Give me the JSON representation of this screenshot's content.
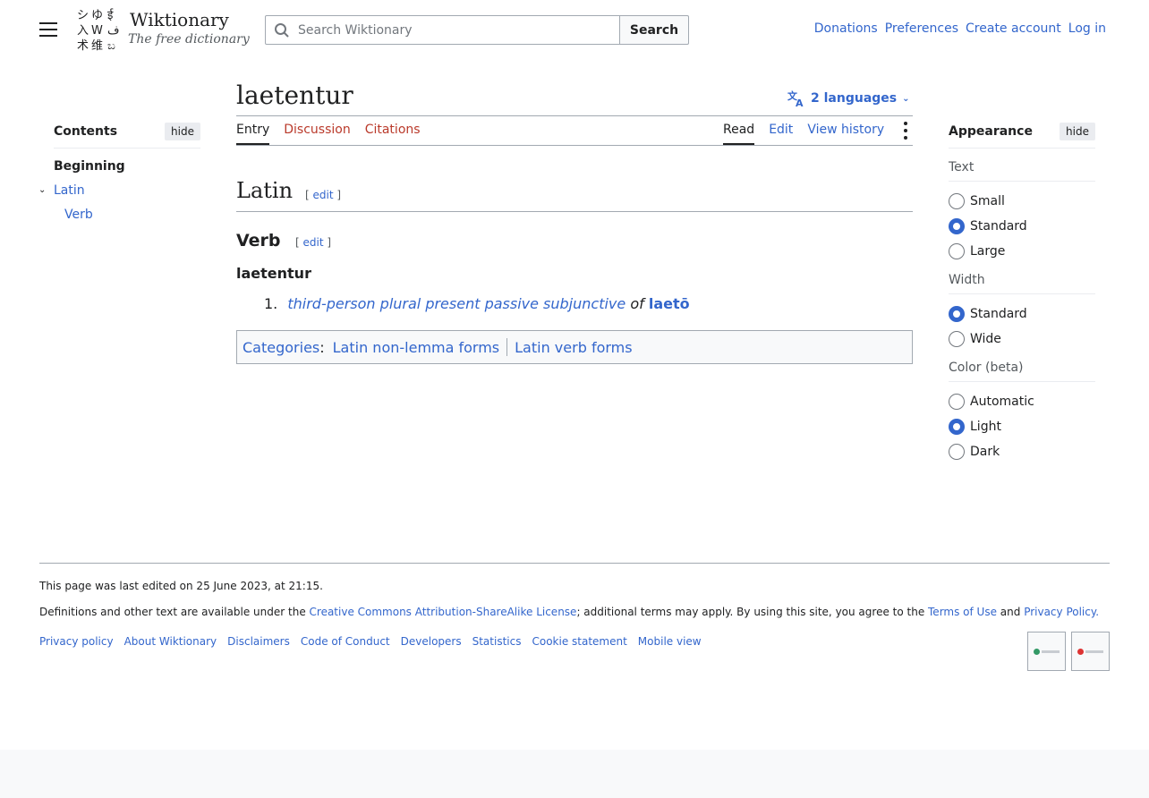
{
  "header": {
    "site_name": "Wiktionary",
    "tagline": "The free dictionary",
    "search_placeholder": "Search Wiktionary",
    "search_button": "Search",
    "user_links": [
      "Donations",
      "Preferences",
      "Create account",
      "Log in"
    ]
  },
  "toc": {
    "title": "Contents",
    "hide_label": "hide",
    "beginning": "Beginning",
    "sections": [
      {
        "label": "Latin",
        "children": [
          "Verb"
        ]
      }
    ]
  },
  "page": {
    "title": "laetentur",
    "languages_label": "2 languages",
    "tabs_left": [
      "Entry",
      "Discussion",
      "Citations"
    ],
    "tabs_right": [
      "Read",
      "Edit",
      "View history"
    ]
  },
  "content": {
    "language_heading": "Latin",
    "pos_heading": "Verb",
    "edit_open": "[",
    "edit_label": "edit",
    "edit_close": "]",
    "headword": "laetentur",
    "definition": {
      "number": "1.",
      "form": "third-person plural present passive subjunctive",
      "of": "of",
      "lemma": "laetō"
    },
    "categories_label": "Categories",
    "categories_colon": ":",
    "categories": [
      "Latin non-lemma forms",
      "Latin verb forms"
    ]
  },
  "appearance": {
    "title": "Appearance",
    "hide_label": "hide",
    "groups": [
      {
        "label": "Text",
        "options": [
          "Small",
          "Standard",
          "Large"
        ],
        "selected": "Standard"
      },
      {
        "label": "Width",
        "options": [
          "Standard",
          "Wide"
        ],
        "selected": "Standard"
      },
      {
        "label": "Color (beta)",
        "options": [
          "Automatic",
          "Light",
          "Dark"
        ],
        "selected": "Light"
      }
    ]
  },
  "footer": {
    "last_edited": "This page was last edited on 25 June 2023, at 21:15.",
    "license_pre": "Definitions and other text are available under the ",
    "license_link": "Creative Commons Attribution-ShareAlike License",
    "license_mid": "; additional terms may apply. By using this site, you agree to the ",
    "terms_link": "Terms of Use",
    "license_and": " and ",
    "privacy_link": "Privacy Policy.",
    "links": [
      "Privacy policy",
      "About Wiktionary",
      "Disclaimers",
      "Code of Conduct",
      "Developers",
      "Statistics",
      "Cookie statement",
      "Mobile view"
    ]
  },
  "colors": {
    "link": "#3366cc",
    "missing_link": "#ba3a2b",
    "text": "#202122",
    "border": "#a2a9b1"
  }
}
